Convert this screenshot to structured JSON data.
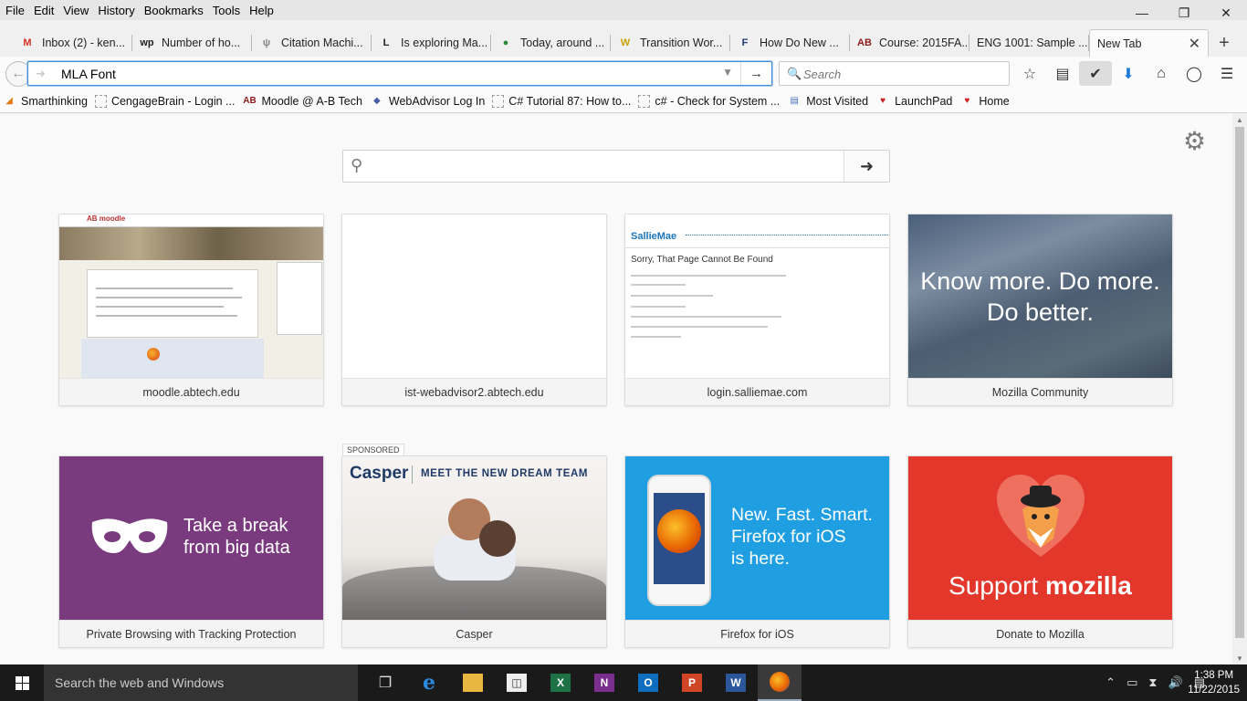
{
  "menu": [
    "File",
    "Edit",
    "View",
    "History",
    "Bookmarks",
    "Tools",
    "Help"
  ],
  "window_controls": {
    "minimize": "—",
    "restore": "❐",
    "close": "✕"
  },
  "tabs": [
    {
      "label": "Inbox (2) - ken...",
      "icon": "gmail-icon",
      "glyph": "M",
      "color": "#d93025"
    },
    {
      "label": "Number of ho...",
      "icon": "washington-post-icon",
      "glyph": "wp",
      "color": "#222"
    },
    {
      "label": "Citation Machi...",
      "icon": "citation-machine-icon",
      "glyph": "ψ",
      "color": "#888"
    },
    {
      "label": "Is exploring Ma...",
      "icon": "article-icon",
      "glyph": "L",
      "color": "#222"
    },
    {
      "label": "Today, around ...",
      "icon": "globe-icon",
      "glyph": "●",
      "color": "#2b8a3e"
    },
    {
      "label": "Transition Wor...",
      "icon": "writing-icon",
      "glyph": "W",
      "color": "#c9a000"
    },
    {
      "label": "How Do New ...",
      "icon": "forbes-icon",
      "glyph": "F",
      "color": "#1a3a7a"
    },
    {
      "label": "Course: 2015FA...",
      "icon": "abtech-icon",
      "glyph": "AB",
      "color": "#8b1c1c"
    },
    {
      "label": "ENG 1001: Sample ...",
      "icon": "",
      "glyph": "",
      "color": "#222"
    },
    {
      "label": "New Tab",
      "icon": "",
      "glyph": "",
      "color": "#222",
      "active": true
    }
  ],
  "tab_close": "✕",
  "new_tab": "+",
  "url": {
    "value": "MLA Font",
    "go": "→",
    "dropdown": "▼"
  },
  "search": {
    "placeholder": "Search"
  },
  "bookmarks": [
    {
      "label": "Smarthinking",
      "icon": "smarthinking-icon",
      "glyph": "◢",
      "color": "#e07a10"
    },
    {
      "label": "CengageBrain - Login ...",
      "icon": "blank-page-icon",
      "glyph": "",
      "color": "#999"
    },
    {
      "label": "Moodle @ A-B Tech",
      "icon": "abtech-icon",
      "glyph": "AB",
      "color": "#8b1c1c"
    },
    {
      "label": "WebAdvisor Log In",
      "icon": "webadvisor-icon",
      "glyph": "◆",
      "color": "#4a5ea8"
    },
    {
      "label": "C# Tutorial 87: How to...",
      "icon": "blank-page-icon",
      "glyph": "",
      "color": "#999"
    },
    {
      "label": "c# - Check for System ...",
      "icon": "blank-page-icon",
      "glyph": "",
      "color": "#999"
    },
    {
      "label": "Most Visited",
      "icon": "most-visited-icon",
      "glyph": "▤",
      "color": "#4a6fbf"
    },
    {
      "label": "LaunchPad",
      "icon": "launchpad-icon",
      "glyph": "♥",
      "color": "#cc2222"
    },
    {
      "label": "Home",
      "icon": "launchpad-icon",
      "glyph": "♥",
      "color": "#cc2222"
    }
  ],
  "newtab": {
    "sponsored": "SPONSORED",
    "tiles": [
      {
        "label": "moodle.abtech.edu",
        "logo": "AB moodle"
      },
      {
        "label": "ist-webadvisor2.abtech.edu"
      },
      {
        "label": "login.salliemae.com",
        "logo": "SallieMae",
        "heading": "Sorry, That Page Cannot Be Found"
      },
      {
        "label": "Mozilla Community",
        "line1": "Know more. Do more.",
        "line2": "Do better."
      },
      {
        "label": "Private Browsing with Tracking Protection",
        "line1": "Take a break",
        "line2": "from big data"
      },
      {
        "label": "Casper",
        "brand": "Casper",
        "tagline": "MEET THE NEW DREAM TEAM"
      },
      {
        "label": "Firefox for iOS",
        "line1": "New. Fast. Smart.",
        "line2": "Firefox for iOS",
        "line3": "is here."
      },
      {
        "label": "Donate to Mozilla",
        "text_a": "Support ",
        "text_b": "mozilla"
      }
    ]
  },
  "taskbar": {
    "search_placeholder": "Search the web and Windows",
    "time": "1:38 PM",
    "date": "11/22/2015"
  }
}
